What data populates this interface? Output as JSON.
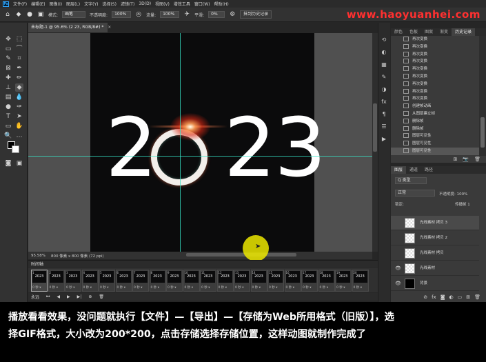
{
  "app": {
    "logo": "Ps",
    "menu": [
      "文件(F)",
      "编辑(E)",
      "图像(I)",
      "图层(L)",
      "文字(Y)",
      "选择(S)",
      "滤镜(T)",
      "3D(D)",
      "视图(V)",
      "增效工具",
      "窗口(W)",
      "帮助(H)"
    ]
  },
  "options": {
    "mode_label": "模式:",
    "mode_value": "画笔",
    "opacity_label": "不透明度:",
    "opacity_value": "100%",
    "flow_label": "流量:",
    "flow_value": "100%",
    "smooth_label": "平滑:",
    "smooth_value": "0%",
    "history_button": "抹到历史记录"
  },
  "watermark": "www.haoyuanhei.com",
  "document": {
    "tab_title": "未标题-1 @ 95.6% (2 23, RGB/8#) *",
    "close": "×",
    "artwork": {
      "d1": "2",
      "d2": "2",
      "d3": "3"
    }
  },
  "status": {
    "zoom": "95.58%",
    "size": "800 像素 x 800 像素 (72 ppi)"
  },
  "timeline": {
    "title": "时间轴",
    "frames": [
      {
        "num": "1",
        "thumb": "2023",
        "dur": "0 秒 ▾"
      },
      {
        "num": "2",
        "thumb": "2023",
        "dur": "0 秒 ▾"
      },
      {
        "num": "3",
        "thumb": "2023",
        "dur": "0 秒 ▾"
      },
      {
        "num": "4",
        "thumb": "2023",
        "dur": "0 秒 ▾"
      },
      {
        "num": "5",
        "thumb": "2023",
        "dur": "0 秒 ▾"
      },
      {
        "num": "6",
        "thumb": "2023",
        "dur": "0 秒 ▾"
      },
      {
        "num": "7",
        "thumb": "2023",
        "dur": "0 秒 ▾"
      },
      {
        "num": "8",
        "thumb": "2023",
        "dur": "0 秒 ▾"
      },
      {
        "num": "9",
        "thumb": "2023",
        "dur": "0 秒 ▾"
      },
      {
        "num": "10",
        "thumb": "2023",
        "dur": "0 秒 ▾"
      },
      {
        "num": "11",
        "thumb": "2023",
        "dur": "0 秒 ▾"
      },
      {
        "num": "12",
        "thumb": "2023",
        "dur": "0 秒 ▾"
      },
      {
        "num": "13",
        "thumb": "2023",
        "dur": "0 秒 ▾"
      },
      {
        "num": "14",
        "thumb": "2023",
        "dur": "0 秒 ▾"
      },
      {
        "num": "15",
        "thumb": "2023",
        "dur": "0 秒 ▾"
      },
      {
        "num": "16",
        "thumb": "2023",
        "dur": "0 秒 ▾"
      },
      {
        "num": "17",
        "thumb": "2023",
        "dur": "0 秒 ▾"
      },
      {
        "num": "18",
        "thumb": "2023",
        "dur": "0 秒 ▾"
      },
      {
        "num": "19",
        "thumb": "2023",
        "dur": "0 秒 ▾"
      },
      {
        "num": "20",
        "thumb": "2023",
        "dur": "0 秒 ▾"
      }
    ],
    "loop": "永远",
    "controls": [
      "⏮",
      "◀",
      "▶",
      "▶|",
      "⊕",
      "🗑"
    ]
  },
  "history": {
    "tabs": [
      "颜色",
      "色板",
      "图案",
      "渐变",
      "历史记录"
    ],
    "items": [
      "再次变换",
      "再次变换",
      "再次变换",
      "再次变换",
      "再次变换",
      "再次变换",
      "再次变换",
      "再次变换",
      "再次变换",
      "创建帧动画",
      "从图层建立帧",
      "删除帧",
      "删除帧",
      "图层可见性",
      "图层可见性",
      "图层可见性"
    ]
  },
  "layers": {
    "tabs": [
      "图层",
      "通道",
      "路径"
    ],
    "kind": "Q 类型",
    "blend_mode": "正常",
    "opacity_label": "不透明度: 100%",
    "lock_label": "锁定:",
    "fill_label": "填充: 100%",
    "frame_propagate": "传播帧 1",
    "rows": [
      {
        "name": "光线素材 拷贝 3",
        "visible": false
      },
      {
        "name": "光线素材 拷贝 2",
        "visible": false
      },
      {
        "name": "光线素材 拷贝",
        "visible": false
      },
      {
        "name": "光线素材",
        "visible": true
      },
      {
        "name": "背景",
        "visible": true
      }
    ]
  },
  "subtitle": {
    "line1": "播放看看效果，没问题就执行【文件】—【导出】—【存储为Web所用格式（旧版）】，选",
    "line2": "择GIF格式，大小改为200*200，点击存储选择存储位置，这样动图就制作完成了"
  }
}
